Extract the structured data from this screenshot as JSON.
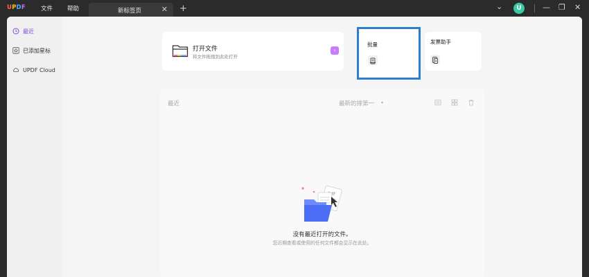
{
  "titlebar": {
    "logo": {
      "u": "U",
      "p": "P",
      "d": "D",
      "f": "F"
    },
    "menu": [
      "文件",
      "帮助"
    ],
    "tab_label": "新标签页",
    "tab_close": "✕",
    "new_tab": "+",
    "avatar_letter": "U",
    "controls": {
      "dropdown": "⌄",
      "minimize": "—",
      "restore": "❐",
      "close": "✕"
    }
  },
  "sidebar": {
    "items": [
      {
        "label": "最近",
        "icon": "clock-icon",
        "active": true
      },
      {
        "label": "已添加星标",
        "icon": "star-icon",
        "active": false
      },
      {
        "label": "UPDF Cloud",
        "icon": "cloud-icon",
        "active": false
      }
    ]
  },
  "quick_actions": {
    "open_file": {
      "title": "打开文件",
      "subtitle": "将文件拖拽到此处打开",
      "arrow": "›"
    },
    "batch": {
      "title": "批量"
    },
    "invoice": {
      "title": "发票助手"
    }
  },
  "recent": {
    "label": "最近",
    "sort_label": "最新的排第一",
    "sort_arrow": "▾",
    "empty_title": "没有最近打开的文件。",
    "empty_subtitle": "您近期查看或使用的任何文件都会显示在此处。"
  },
  "colors": {
    "accent": "#7b4fd8",
    "highlight_border": "#2f7fd1",
    "avatar": "#39c9a4",
    "arrow": "#c97bff"
  }
}
